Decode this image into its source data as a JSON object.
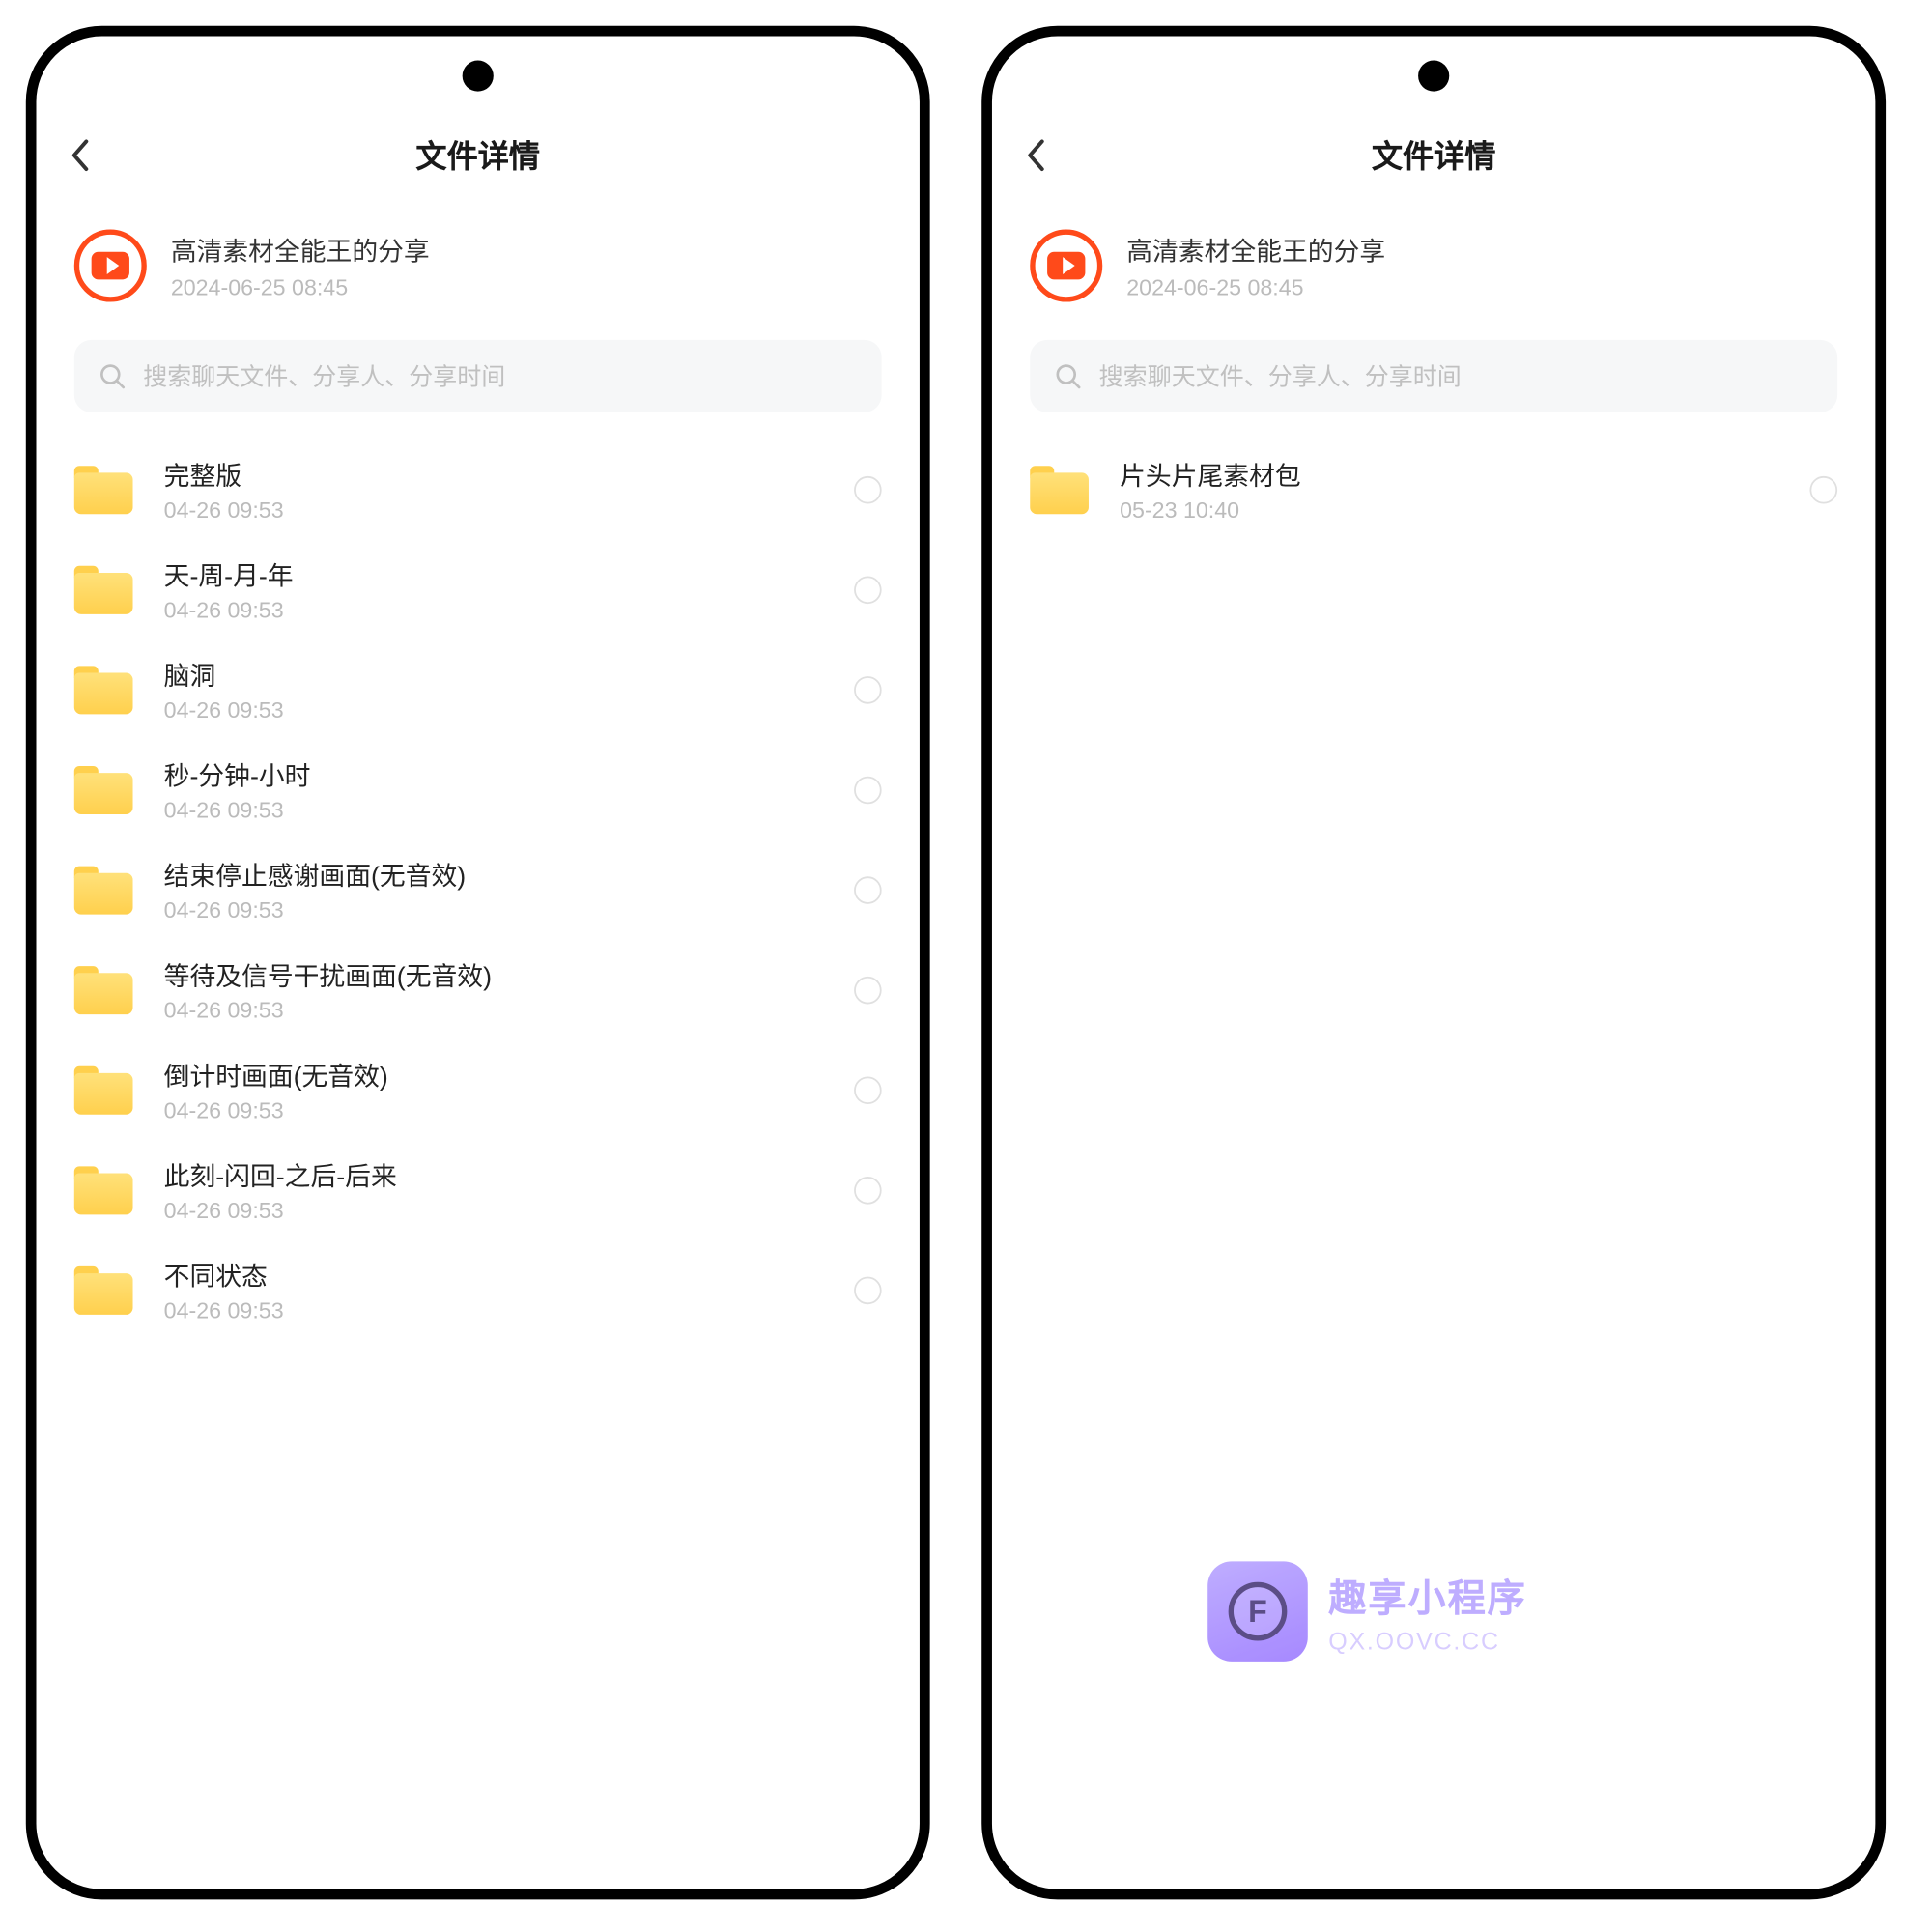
{
  "header": {
    "title": "文件详情"
  },
  "share": {
    "title": "高清素材全能王的分享",
    "time": "2024-06-25  08:45"
  },
  "search": {
    "placeholder": "搜索聊天文件、分享人、分享时间"
  },
  "watermark": {
    "title": "趣享小程序",
    "subtitle": "QX.OOVC.CC",
    "letter": "F"
  },
  "phones": [
    {
      "files": [
        {
          "name": "完整版",
          "time": "04-26  09:53"
        },
        {
          "name": "天-周-月-年",
          "time": "04-26  09:53"
        },
        {
          "name": "脑洞",
          "time": "04-26  09:53"
        },
        {
          "name": "秒-分钟-小时",
          "time": "04-26  09:53"
        },
        {
          "name": "结束停止感谢画面(无音效)",
          "time": "04-26  09:53"
        },
        {
          "name": "等待及信号干扰画面(无音效)",
          "time": "04-26  09:53"
        },
        {
          "name": "倒计时画面(无音效)",
          "time": "04-26  09:53"
        },
        {
          "name": "此刻-闪回-之后-后来",
          "time": "04-26  09:53"
        },
        {
          "name": "不同状态",
          "time": "04-26  09:53"
        }
      ]
    },
    {
      "files": [
        {
          "name": "片头片尾素材包",
          "time": "05-23  10:40"
        }
      ]
    }
  ]
}
